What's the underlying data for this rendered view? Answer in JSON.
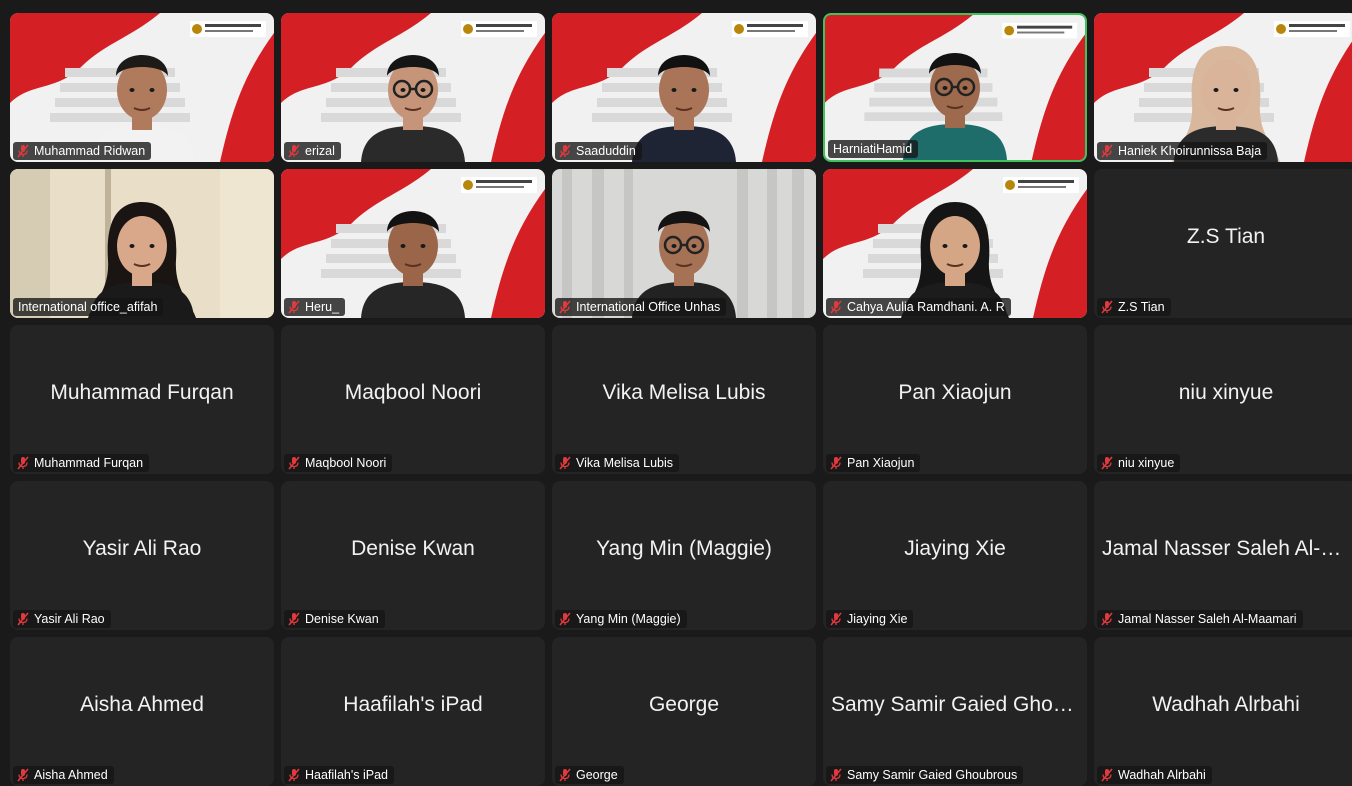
{
  "participants": [
    {
      "name": "Muhammad Ridwan",
      "video": true,
      "bg": "campus",
      "skin": "#b07a5c",
      "hair": "#1d1a18",
      "shirt": "#f2f2f2",
      "muted": true
    },
    {
      "name": "erizal",
      "video": true,
      "bg": "campus",
      "skin": "#c69579",
      "hair": "#151515",
      "shirt": "#2a2a2a",
      "muted": true,
      "glasses": true
    },
    {
      "name": "Saaduddin",
      "video": true,
      "bg": "campus",
      "skin": "#a97458",
      "hair": "#111111",
      "shirt": "#1e2433",
      "muted": true
    },
    {
      "name": "HarniatiHamid",
      "video": true,
      "bg": "campus",
      "skin": "#9d6a4e",
      "hair": "#121212",
      "shirt": "#1f6d6b",
      "muted": false,
      "active": true,
      "glasses": true
    },
    {
      "name": "Haniek Khoirunnissa Baja",
      "video": true,
      "bg": "campus",
      "skin": "#d9b39a",
      "hair": "#d8b79c",
      "shirt": "#2b2b2b",
      "muted": true,
      "hijab": true
    },
    {
      "name": "International office_afifah",
      "video": true,
      "bg": "room",
      "skin": "#d9a88a",
      "hair": "#1a1412",
      "shirt": "#1a1a1a",
      "muted": false,
      "hijab": true
    },
    {
      "name": "Heru_",
      "video": true,
      "bg": "campus",
      "skin": "#9a6548",
      "hair": "#121212",
      "shirt": "#262626",
      "muted": true
    },
    {
      "name": "International Office Unhas",
      "video": true,
      "bg": "curtain",
      "skin": "#a57256",
      "hair": "#141414",
      "shirt": "#222",
      "muted": true,
      "glasses": true
    },
    {
      "name": "Cahya Aulia Ramdhani. A. R",
      "video": true,
      "bg": "campus",
      "skin": "#d4a686",
      "hair": "#151515",
      "shirt": "#1c1c1c",
      "muted": true,
      "hijab": true
    },
    {
      "name": "Z.S Tian",
      "video": false,
      "muted": true
    },
    {
      "name": "Muhammad Furqan",
      "video": false,
      "muted": true
    },
    {
      "name": "Maqbool Noori",
      "video": false,
      "muted": true
    },
    {
      "name": "Vika Melisa Lubis",
      "video": false,
      "muted": true
    },
    {
      "name": "Pan Xiaojun",
      "video": false,
      "muted": true
    },
    {
      "name": "niu xinyue",
      "video": false,
      "muted": true
    },
    {
      "name": "Yasir Ali Rao",
      "video": false,
      "muted": true
    },
    {
      "name": "Denise Kwan",
      "video": false,
      "muted": true
    },
    {
      "name": "Yang Min (Maggie)",
      "video": false,
      "muted": true
    },
    {
      "name": "Jiaying Xie",
      "video": false,
      "muted": true
    },
    {
      "name": "Jamal Nasser Saleh Al-Maamari",
      "video": false,
      "muted": true
    },
    {
      "name": "Aisha Ahmed",
      "video": false,
      "muted": true
    },
    {
      "name": "Haafilah's iPad",
      "video": false,
      "muted": true
    },
    {
      "name": "George",
      "video": false,
      "muted": true
    },
    {
      "name": "Samy Samir Gaied Ghoubrous",
      "video": false,
      "muted": true
    },
    {
      "name": "Wadhah Alrbahi",
      "video": false,
      "muted": true
    }
  ],
  "colors": {
    "tile": "#242424",
    "active_border": "#3fc15c",
    "muted_icon": "#e0393e",
    "brand_red": "#d41f25"
  },
  "icons": {
    "muted": "mic-muted-icon"
  }
}
